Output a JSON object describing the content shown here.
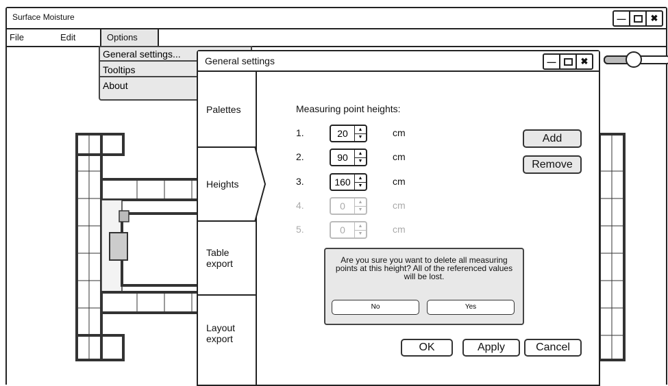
{
  "window": {
    "title": "Surface Moisture"
  },
  "menubar": {
    "file": "File",
    "edit": "Edit",
    "options": "Options"
  },
  "options_menu": {
    "items": [
      "General settings...",
      "Tooltips",
      "About"
    ]
  },
  "zoom_slider": {
    "level": 0.45
  },
  "dialog": {
    "title": "General settings",
    "nav": [
      "Palettes",
      "Heights",
      "Table export",
      "Layout export"
    ],
    "selected_nav": "Heights",
    "heading": "Measuring point heights:",
    "rows": [
      {
        "index": "1.",
        "value": "20",
        "unit": "cm",
        "enabled": true
      },
      {
        "index": "2.",
        "value": "90",
        "unit": "cm",
        "enabled": true
      },
      {
        "index": "3.",
        "value": "160",
        "unit": "cm",
        "enabled": true
      },
      {
        "index": "4.",
        "value": "0",
        "unit": "cm",
        "enabled": false
      },
      {
        "index": "5.",
        "value": "0",
        "unit": "cm",
        "enabled": false
      }
    ],
    "add_label": "Add",
    "remove_label": "Remove",
    "confirm": {
      "message": "Are you sure you want to delete all measuring points at this height? All of the referenced values will be lost.",
      "no_label": "No",
      "yes_label": "Yes"
    },
    "ok_label": "OK",
    "apply_label": "Apply",
    "cancel_label": "Cancel"
  }
}
